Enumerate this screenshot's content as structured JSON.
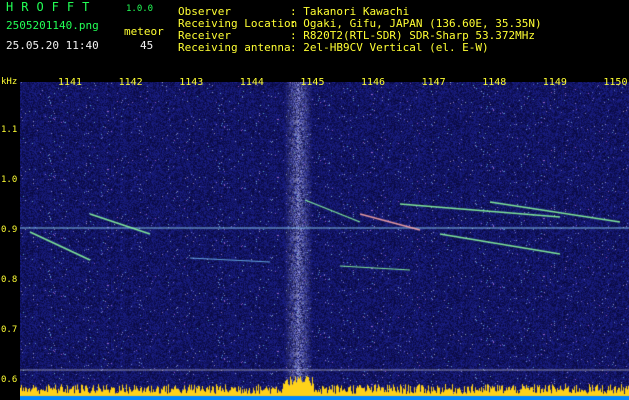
{
  "app": {
    "logo": "HROFFT",
    "version": "1.0.0",
    "filename": "2505201140.png",
    "meteor_label": "meteor",
    "meteor_count": "45",
    "datetime": "25.05.20 11:40"
  },
  "info": [
    {
      "label": "Observer",
      "value": ": Takanori Kawachi"
    },
    {
      "label": "Receiving Location",
      "value": ": Ogaki, Gifu, JAPAN (136.60E, 35.35N)"
    },
    {
      "label": "Receiver",
      "value": ": R820T2(RTL-SDR) SDR-Sharp 53.372MHz"
    },
    {
      "label": "Receiving antenna",
      "value": ": 2el-HB9CV Vertical (el. E-W)"
    }
  ],
  "axis": {
    "unit_label": "kHz",
    "x_ticks": [
      "1141",
      "1142",
      "1143",
      "1144",
      "1145",
      "1146",
      "1147",
      "1148",
      "1149",
      "1150"
    ],
    "y_ticks": [
      "1.1",
      "1.0",
      "0.9",
      "0.8",
      "0.7",
      "0.6"
    ]
  },
  "colors": {
    "background": "#000000",
    "text_green": "#22ff55",
    "text_yellow": "#ffff33",
    "noise_blue": "#1a1aa0",
    "meteor": "#aaffaa",
    "baseline": "#ffd21a"
  }
}
